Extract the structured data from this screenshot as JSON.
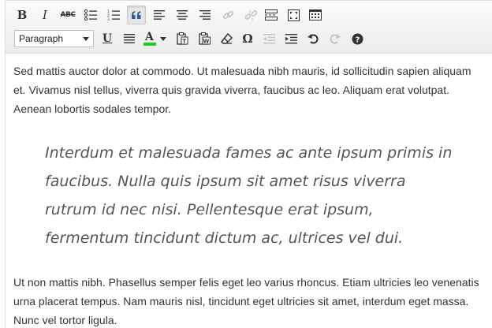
{
  "toolbar": {
    "row1": [
      {
        "name": "bold-button",
        "label": "B",
        "active": false
      },
      {
        "name": "italic-button",
        "label": "I",
        "active": false
      },
      {
        "name": "strikethrough-button",
        "label": "ABC",
        "active": false
      },
      {
        "name": "bulleted-list-button",
        "icon": "bullet-list-icon",
        "active": false
      },
      {
        "name": "numbered-list-button",
        "icon": "numbered-list-icon",
        "active": false
      },
      {
        "name": "blockquote-button",
        "icon": "quote-icon",
        "active": true
      },
      {
        "name": "align-left-button",
        "icon": "align-left-icon",
        "active": false
      },
      {
        "name": "align-center-button",
        "icon": "align-center-icon",
        "active": false
      },
      {
        "name": "align-right-button",
        "icon": "align-right-icon",
        "active": false
      },
      {
        "name": "insert-link-button",
        "icon": "link-icon",
        "disabled": true
      },
      {
        "name": "remove-link-button",
        "icon": "unlink-icon",
        "disabled": true
      },
      {
        "name": "insert-more-button",
        "icon": "read-more-icon",
        "active": false
      },
      {
        "name": "fullscreen-button",
        "icon": "fullscreen-icon",
        "active": false
      },
      {
        "name": "toolbar-toggle-button",
        "icon": "kitchen-sink-icon",
        "active": false
      }
    ],
    "format_select": {
      "value": "Paragraph"
    },
    "row2": [
      {
        "name": "underline-button",
        "label": "U"
      },
      {
        "name": "justify-button",
        "icon": "justify-icon"
      },
      {
        "name": "text-color-button",
        "label": "A",
        "icon": "text-color-icon",
        "swatch": "#22cc22"
      },
      {
        "name": "paste-text-button",
        "icon": "paste-text-icon"
      },
      {
        "name": "paste-word-button",
        "icon": "paste-word-icon"
      },
      {
        "name": "clear-formatting-button",
        "icon": "eraser-icon"
      },
      {
        "name": "special-character-button",
        "label": "Ω"
      },
      {
        "name": "outdent-button",
        "icon": "outdent-icon",
        "disabled": true
      },
      {
        "name": "indent-button",
        "icon": "indent-icon"
      },
      {
        "name": "undo-button",
        "icon": "undo-icon"
      },
      {
        "name": "redo-button",
        "icon": "redo-icon",
        "disabled": true
      },
      {
        "name": "help-button",
        "icon": "help-icon"
      }
    ]
  },
  "content": {
    "paragraph1": "Sed mattis auctor dolor at commodo. Ut malesuada nibh mauris, id sollicitudin sapien aliquam et. Vivamus nisl tellus, viverra quis gravida viverra, faucibus ac leo. Aliquam erat volutpat. Aenean lobortis sodales tempor.",
    "blockquote": "Interdum et malesuada fames ac ante ipsum primis in faucibus. Nulla quis ipsum sit amet risus viverra rutrum id nec nisi. Pellentesque erat ipsum, fermentum tincidunt dictum ac, ultrices vel dui.",
    "paragraph2": "Ut non mattis nibh. Phasellus semper felis eget leo varius rhoncus. Etiam ultricies leo venenatis urna placerat tempus. Nam mauris nisl, tincidunt eget ultricies sit amet, interdum eget massa. Nunc vel tortor ligula."
  }
}
